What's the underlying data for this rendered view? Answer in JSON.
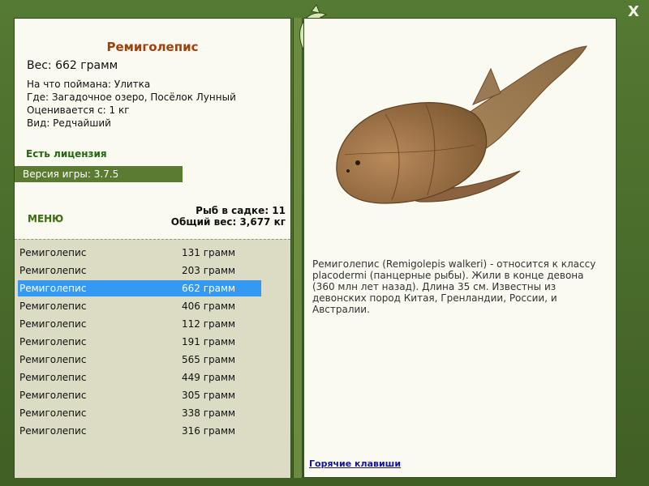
{
  "window": {
    "close_label": "X"
  },
  "fish": {
    "title": "Ремиголепис",
    "weight": "Вес: 662 грамм",
    "caught_with": "На что поймана: Улитка",
    "location": "Где: Загадочное озеро, Посёлок Лунный",
    "valued_from": "Оценивается с: 1 кг",
    "rarity": "Вид: Редчайший"
  },
  "license": "Есть лицензия",
  "version": "Версия игры: 3.7.5",
  "menu_label": "меню",
  "stats": {
    "count": "Рыб в садке: 11",
    "total_weight": "Общий вес: 3,677 кг"
  },
  "catch_list": [
    {
      "name": "Ремиголепис",
      "weight": "131 грамм"
    },
    {
      "name": "Ремиголепис",
      "weight": "203 грамм"
    },
    {
      "name": "Ремиголепис",
      "weight": "662 грамм"
    },
    {
      "name": "Ремиголепис",
      "weight": "406 грамм"
    },
    {
      "name": "Ремиголепис",
      "weight": "112 грамм"
    },
    {
      "name": "Ремиголепис",
      "weight": "191 грамм"
    },
    {
      "name": "Ремиголепис",
      "weight": "565 грамм"
    },
    {
      "name": "Ремиголепис",
      "weight": "449 грамм"
    },
    {
      "name": "Ремиголепис",
      "weight": "305 грамм"
    },
    {
      "name": "Ремиголепис",
      "weight": "338 грамм"
    },
    {
      "name": "Ремиголепис",
      "weight": "316 грамм"
    }
  ],
  "selected_index": 2,
  "description": "Ремиголепис (Remigolepis walkeri) - относится к классу placodermi (панцерные рыбы). Жили в конце девона (360 млн лет назад). Длина 35 см. Известны из девонских пород Китая, Гренландии, России, и Австралии.",
  "hotkeys_label": "Горячие клавиши",
  "colors": {
    "frame_green": "#557a33",
    "title_orange": "#a0400c",
    "license_green": "#1f6a10",
    "selection_blue": "#3399f3",
    "link_blue": "#13149a"
  }
}
